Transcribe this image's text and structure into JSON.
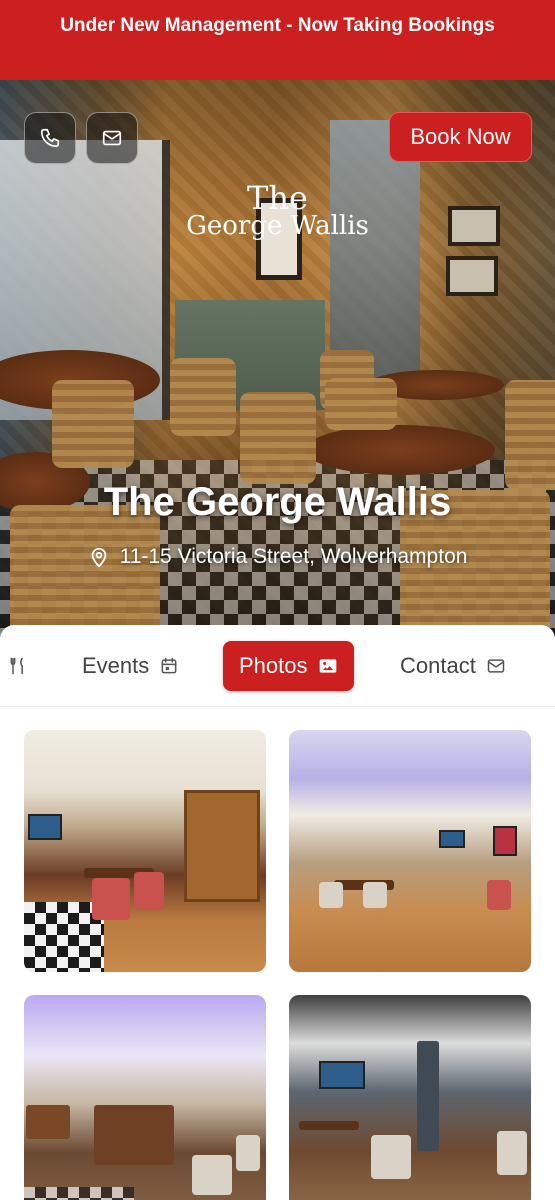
{
  "banner": {
    "text": "Under New Management - Now Taking Bookings"
  },
  "header": {
    "phone_icon": "phone-icon",
    "mail_icon": "mail-icon",
    "logo_line1": "The",
    "logo_line2": "George Wallis",
    "book_label": "Book Now"
  },
  "hero": {
    "title": "The George Wallis",
    "address": "11-15 Victoria Street, Wolverhampton",
    "address_icon": "map-pin-icon"
  },
  "tabs": [
    {
      "label": "",
      "icon": "fork-knife-icon",
      "active": false
    },
    {
      "label": "Events",
      "icon": "calendar-icon",
      "active": false
    },
    {
      "label": "Photos",
      "icon": "image-icon",
      "active": true
    },
    {
      "label": "Contact",
      "icon": "mail-icon",
      "active": false
    }
  ],
  "photos": [
    {
      "alt": "pub-interior-1"
    },
    {
      "alt": "pub-interior-2"
    },
    {
      "alt": "pub-interior-3"
    },
    {
      "alt": "pub-interior-4"
    }
  ],
  "colors": {
    "brand_red": "#cc1f1f",
    "white": "#ffffff",
    "tab_text": "#444444"
  }
}
